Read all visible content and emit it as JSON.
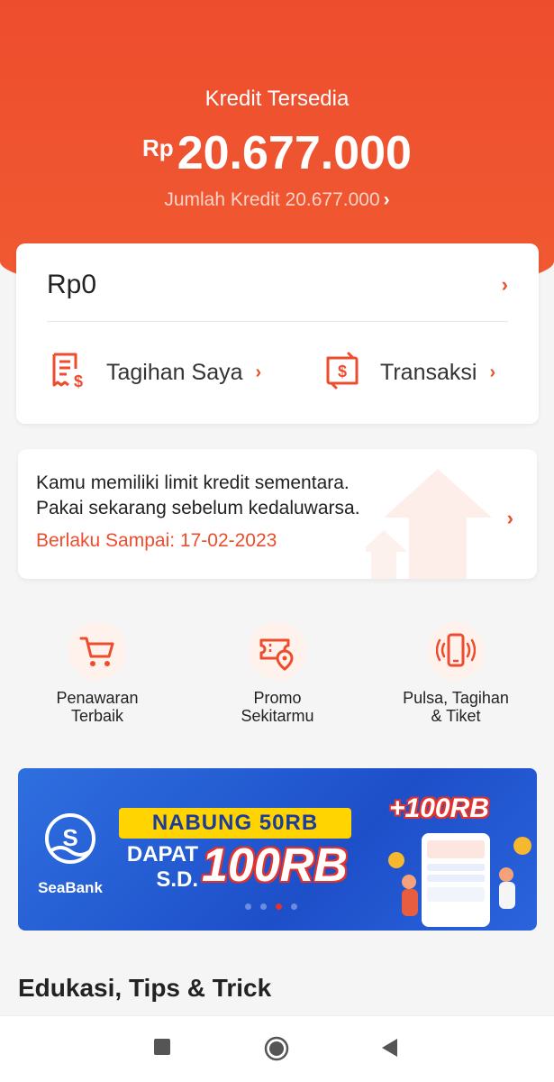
{
  "hero": {
    "label": "Kredit Tersedia",
    "currency": "Rp",
    "amount": "20.677.000",
    "sub_label": "Jumlah Kredit 20.677.000",
    "sub_chevron": "›"
  },
  "balance_card": {
    "amount": "Rp0",
    "chevron": "›",
    "actions": [
      {
        "label": "Tagihan Saya",
        "icon": "bill-icon",
        "chevron": "›"
      },
      {
        "label": "Transaksi",
        "icon": "transaction-icon",
        "chevron": "›"
      }
    ]
  },
  "notice": {
    "line1": "Kamu memiliki limit kredit sementara.",
    "line2": "Pakai sekarang sebelum kedaluwarsa.",
    "valid": "Berlaku Sampai: 17-02-2023",
    "chevron": "›"
  },
  "menu": [
    {
      "line1": "Penawaran",
      "line2": "Terbaik",
      "icon": "cart-icon"
    },
    {
      "line1": "Promo",
      "line2": "Sekitarmu",
      "icon": "voucher-location-icon"
    },
    {
      "line1": "Pulsa, Tagihan",
      "line2": "& Tiket",
      "icon": "phone-icon"
    }
  ],
  "banner": {
    "brand": "SeaBank",
    "pill": "NABUNG 50RB",
    "dapat": "DAPAT",
    "sd": "S.D.",
    "big": "100RB",
    "plus": "+100RB",
    "active_dot": 2,
    "dot_count": 4
  },
  "section": {
    "title": "Edukasi, Tips & Trick"
  },
  "colors": {
    "primary": "#ee4d2d",
    "banner_blue": "#1d4fc9",
    "pill_yellow": "#ffd400"
  }
}
